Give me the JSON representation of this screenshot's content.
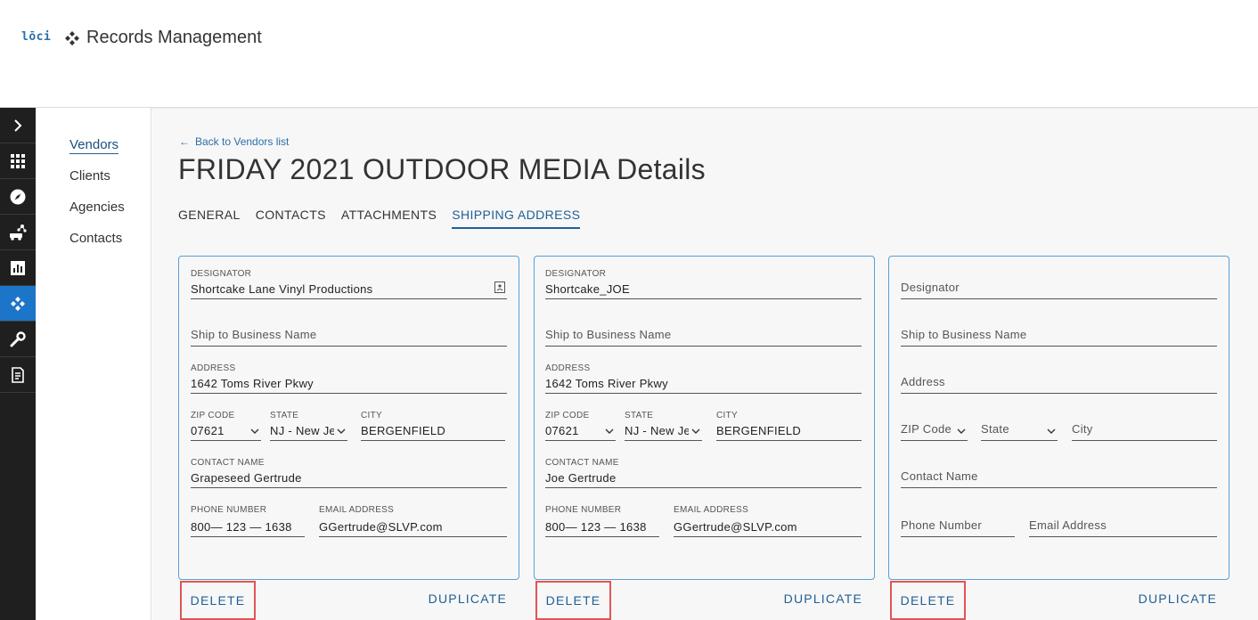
{
  "header": {
    "logo": "lōci",
    "app_title": "Records Management"
  },
  "rail": {
    "items": [
      {
        "icon": "chevron-right-icon"
      },
      {
        "icon": "grid-icon"
      },
      {
        "icon": "compass-icon"
      },
      {
        "icon": "vehicle-network-icon"
      },
      {
        "icon": "bar-chart-icon"
      },
      {
        "icon": "records-icon",
        "active": true
      },
      {
        "icon": "wrench-icon"
      },
      {
        "icon": "document-icon"
      }
    ]
  },
  "subnav": {
    "items": [
      "Vendors",
      "Clients",
      "Agencies",
      "Contacts"
    ]
  },
  "main": {
    "back_link": "Back to Vendors list",
    "title": "FRIDAY 2021 OUTDOOR MEDIA Details",
    "tabs": [
      "GENERAL",
      "CONTACTS",
      "ATTACHMENTS",
      "SHIPPING ADDRESS"
    ]
  },
  "cards": [
    {
      "designator_label": "DESIGNATOR",
      "designator": "Shortcake Lane Vinyl Productions",
      "business_placeholder": "Ship to Business Name",
      "address_label": "ADDRESS",
      "address": "1642 Toms River Pkwy",
      "zip_label": "ZIP CODE",
      "zip": "07621",
      "state_label": "STATE",
      "state": "NJ - New Jersey",
      "city_label": "CITY",
      "city": "BERGENFIELD",
      "contact_label": "CONTACT NAME",
      "contact": "Grapeseed Gertrude",
      "phone_label": "PHONE NUMBER",
      "phone": "800— 123 — 1638",
      "email_label": "EMAIL ADDRESS",
      "email": "GGertrude@SLVP.com",
      "delete": "DELETE",
      "duplicate": "DUPLICATE"
    },
    {
      "designator_label": "DESIGNATOR",
      "designator": "Shortcake_JOE",
      "business_placeholder": "Ship to Business Name",
      "address_label": "ADDRESS",
      "address": "1642 Toms River Pkwy",
      "zip_label": "ZIP CODE",
      "zip": "07621",
      "state_label": "STATE",
      "state": "NJ - New Jersey",
      "city_label": "CITY",
      "city": "BERGENFIELD",
      "contact_label": "CONTACT NAME",
      "contact": "Joe Gertrude",
      "phone_label": "PHONE NUMBER",
      "phone": "800— 123 — 1638",
      "email_label": "EMAIL ADDRESS",
      "email": "GGertrude@SLVP.com",
      "delete": "DELETE",
      "duplicate": "DUPLICATE"
    },
    {
      "designator_placeholder": "Designator",
      "business_placeholder": "Ship to Business Name",
      "address_placeholder": "Address",
      "zip_placeholder": "ZIP Code",
      "state_placeholder": "State",
      "city_placeholder": "City",
      "contact_placeholder": "Contact Name",
      "phone_placeholder": "Phone Number",
      "email_placeholder": "Email Address",
      "delete": "DELETE",
      "duplicate": "DUPLICATE"
    }
  ],
  "colors": {
    "accent": "#1e5f96",
    "rail_bg": "#1f1f1f",
    "rail_active": "#1d75c9",
    "card_border": "#5a9fd4",
    "highlight": "#e05555"
  }
}
